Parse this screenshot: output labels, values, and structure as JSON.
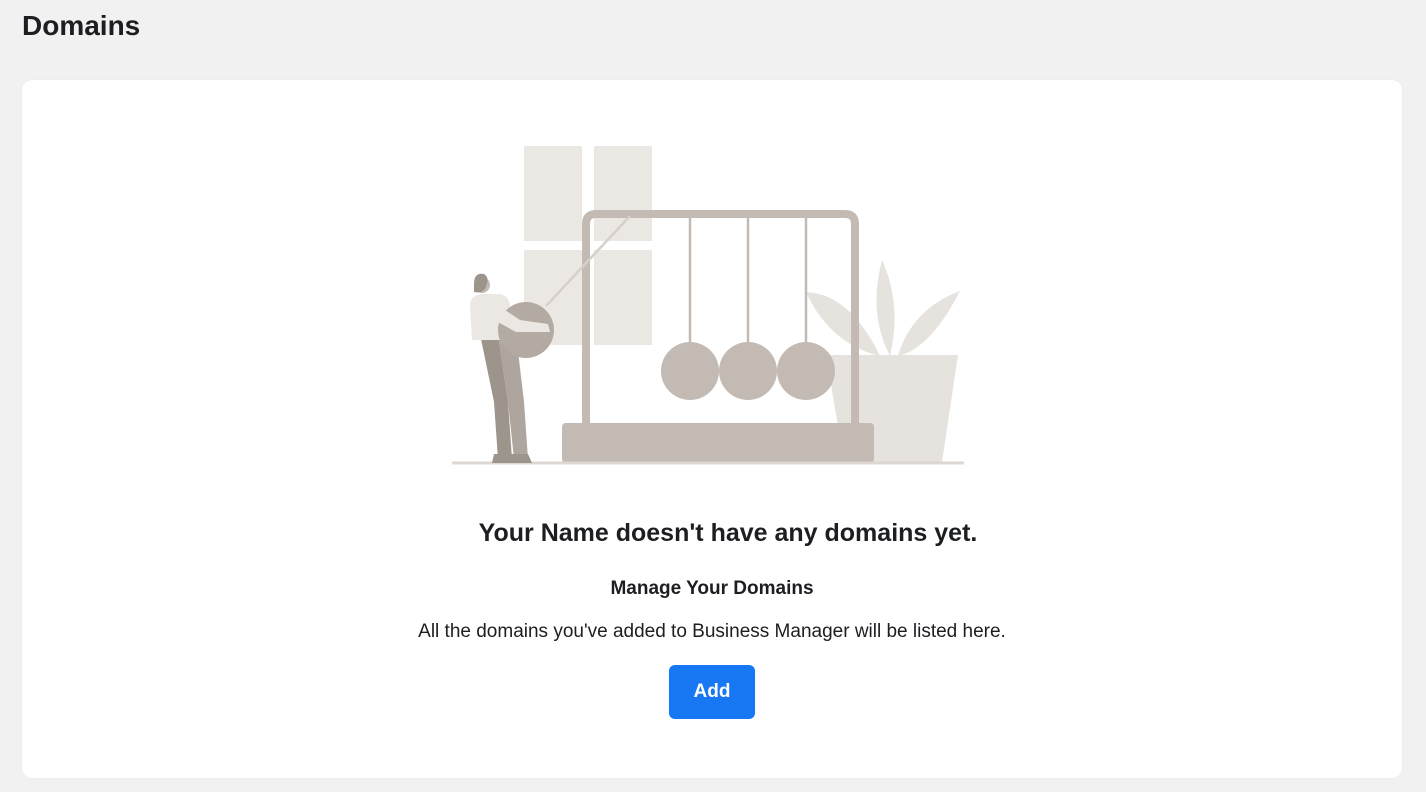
{
  "header": {
    "title": "Domains"
  },
  "empty_state": {
    "heading": "Your Name doesn't have any domains yet.",
    "subheading": "Manage Your Domains",
    "description": "All the domains you've added to Business Manager will be listed here.",
    "add_button_label": "Add",
    "illustration": "newtons-cradle-illustration"
  },
  "colors": {
    "page_background": "#f1f1f1",
    "card_background": "#ffffff",
    "accent": "#1877f2",
    "text": "#1c1e21",
    "illustration_light": "#ebe8e4",
    "illustration_mid": "#c2bab3",
    "illustration_dark": "#9d948c"
  }
}
